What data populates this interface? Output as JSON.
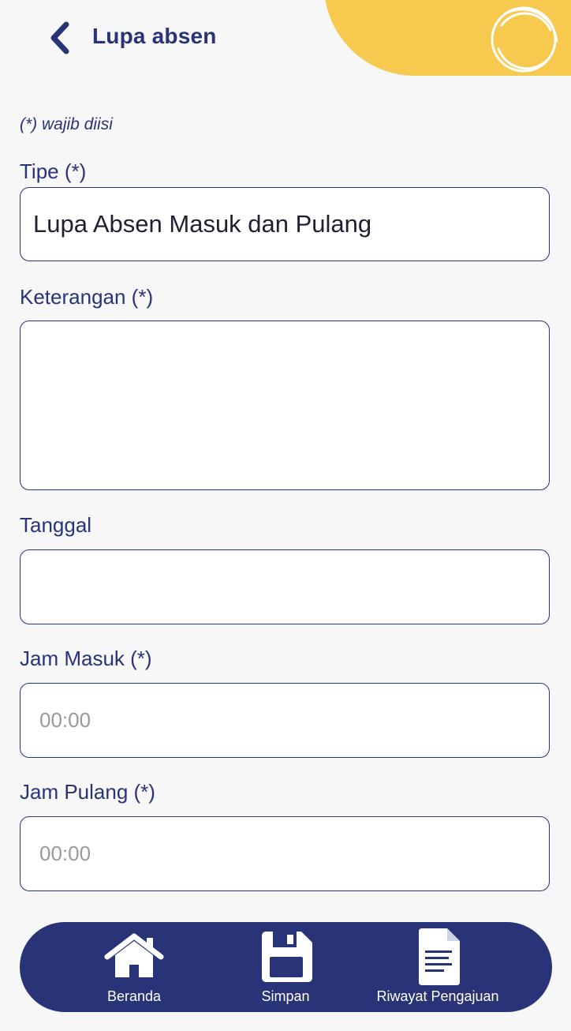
{
  "header": {
    "title": "Lupa absen",
    "back_icon": "chevron-left-icon",
    "accent_color": "#f7c94f",
    "brand_color": "#283378"
  },
  "form": {
    "required_note": "(*) wajib diisi",
    "fields": {
      "tipe": {
        "label": "Tipe (*)",
        "value": "Lupa Absen Masuk dan Pulang"
      },
      "keterangan": {
        "label": "Keterangan (*)",
        "value": ""
      },
      "tanggal": {
        "label": "Tanggal",
        "value": ""
      },
      "jam_masuk": {
        "label": "Jam Masuk (*)",
        "placeholder": "00:00"
      },
      "jam_pulang": {
        "label": "Jam Pulang (*)",
        "placeholder": "00:00"
      }
    }
  },
  "bottom_nav": {
    "items": [
      {
        "label": "Beranda",
        "icon": "home-icon"
      },
      {
        "label": "Simpan",
        "icon": "save-icon"
      },
      {
        "label": "Riwayat Pengajuan",
        "icon": "document-icon"
      }
    ]
  }
}
